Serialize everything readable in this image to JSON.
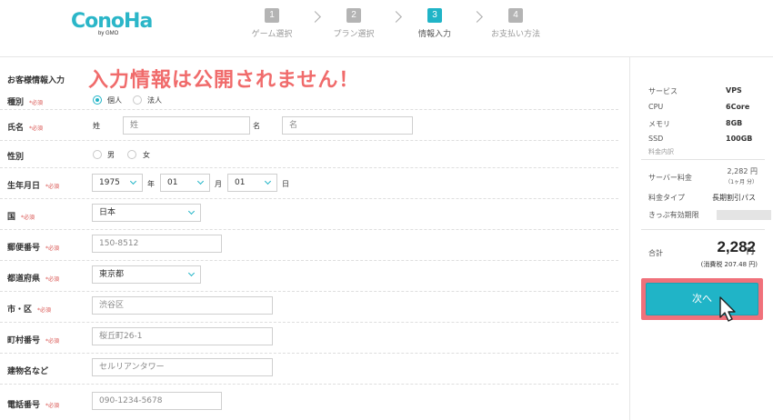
{
  "logo": {
    "main": "ConoHa",
    "sub": "by GMO"
  },
  "steps": [
    {
      "num": "1",
      "label": "ゲーム選択"
    },
    {
      "num": "2",
      "label": "プラン選択"
    },
    {
      "num": "3",
      "label": "情報入力"
    },
    {
      "num": "4",
      "label": "お支払い方法"
    }
  ],
  "active_step": 3,
  "form": {
    "section_title": "お客様情報入力",
    "notice": "入力情報は公開されません！",
    "required_tag": "*必須",
    "type": {
      "label": "種別",
      "options": [
        "個人",
        "法人"
      ],
      "selected": "個人"
    },
    "name": {
      "label": "氏名",
      "last_label": "姓",
      "last_placeholder": "姓",
      "first_label": "名",
      "first_placeholder": "名"
    },
    "gender": {
      "label": "性別",
      "options": [
        "男",
        "女"
      ]
    },
    "birthday": {
      "label": "生年月日",
      "year": "1975",
      "year_unit": "年",
      "month": "01",
      "month_unit": "月",
      "day": "01",
      "day_unit": "日"
    },
    "country": {
      "label": "国",
      "value": "日本"
    },
    "postal": {
      "label": "郵便番号",
      "placeholder": "150-8512"
    },
    "prefecture": {
      "label": "都道府県",
      "value": "東京都"
    },
    "city": {
      "label": "市・区",
      "placeholder": "渋谷区"
    },
    "street": {
      "label": "町村番号",
      "placeholder": "桜丘町26-1"
    },
    "building": {
      "label": "建物名など",
      "placeholder": "セルリアンタワー"
    },
    "phone": {
      "label": "電話番号",
      "placeholder": "090-1234-5678"
    }
  },
  "summary": {
    "specs": [
      {
        "label": "サービス",
        "value": "VPS"
      },
      {
        "label": "CPU",
        "value": "6Core"
      },
      {
        "label": "メモリ",
        "value": "8GB"
      },
      {
        "label": "SSD",
        "value": "100GB"
      }
    ],
    "fee_breakdown_label": "料金内訳",
    "server_fee_label": "サーバー料金",
    "server_fee_value": "2,282 円",
    "server_fee_period": "（1ヶ月 分）",
    "fee_type_label": "料金タイプ",
    "fee_type_value": "長期割引パス",
    "ticket_expiry_label": "きっぷ有効期限",
    "total_label": "合計",
    "total_value": "2,282",
    "total_unit": "円",
    "tax_note": "(消費税 207.48 円)",
    "next_label": "次へ"
  },
  "colors": {
    "accent": "#20b4c7",
    "notice": "#f06b6b",
    "highlight_border": "#f0717b"
  }
}
